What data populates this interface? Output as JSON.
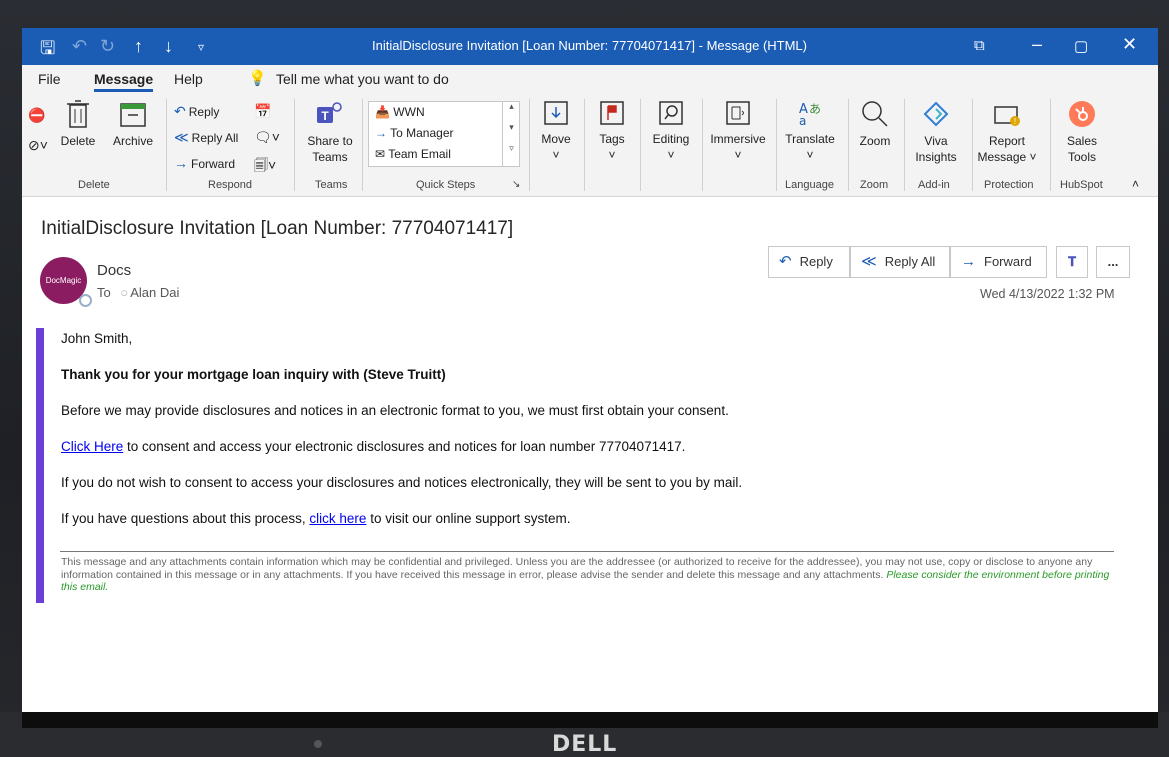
{
  "window": {
    "title": "InitialDisclosure Invitation [Loan Number: 77704071417]  -  Message (HTML)"
  },
  "menu": {
    "items": [
      "File",
      "Message",
      "Help"
    ],
    "tell_me": "Tell me what you want to do"
  },
  "ribbon": {
    "delete": {
      "delete_label": "Delete",
      "archive_label": "Archive",
      "group": "Delete"
    },
    "respond": {
      "reply": "Reply",
      "reply_all": "Reply All",
      "forward": "Forward",
      "group": "Respond"
    },
    "teams": {
      "share_label_1": "Share to",
      "share_label_2": "Teams",
      "group": "Teams"
    },
    "quick_steps": {
      "items": [
        "WWN",
        "To Manager",
        "Team Email"
      ],
      "group": "Quick Steps"
    },
    "move": "Move",
    "tags": "Tags",
    "editing": "Editing",
    "immersive": "Immersive",
    "translate": "Translate",
    "language_group": "Language",
    "zoom": "Zoom",
    "zoom_group": "Zoom",
    "viva_1": "Viva",
    "viva_2": "Insights",
    "addin_group": "Add-in",
    "report_1": "Report",
    "report_2": "Message",
    "protection_group": "Protection",
    "sales_1": "Sales",
    "sales_2": "Tools",
    "hubspot_group": "HubSpot"
  },
  "message": {
    "subject": "InitialDisclosure Invitation [Loan Number: 77704071417]",
    "avatar_text": "DocMagic",
    "sender": "Docs",
    "to_label": "To",
    "recipient": "Alan Dai",
    "date": "Wed 4/13/2022 1:32 PM",
    "actions": {
      "reply": "Reply",
      "reply_all": "Reply All",
      "forward": "Forward",
      "more": "..."
    }
  },
  "body": {
    "greeting": "John Smith,",
    "thanks": "Thank you for your mortgage loan inquiry with (Steve Truitt)",
    "p1": "Before we may provide disclosures and notices in an electronic format to you, we must first obtain your consent.",
    "p2_link": "Click Here",
    "p2_rest": " to consent and access your electronic disclosures and notices for loan number 77704071417.",
    "p3": "If you do not wish to consent to access your disclosures and notices electronically, they will be sent to you by mail.",
    "p4_pre": "If you have questions about this process, ",
    "p4_link": "click here",
    "p4_post": " to visit our online support system.",
    "disclaimer": "This message and any attachments contain information which may be confidential and privileged. Unless you are the addressee (or authorized to receive for the addressee), you may not use, copy or disclose to anyone any information contained in this message or in any attachments. If you have received this message in error, please advise the sender and delete this message and any attachments.",
    "environment": "Please consider the environment before printing this email."
  },
  "device": {
    "brand": "DELL"
  }
}
